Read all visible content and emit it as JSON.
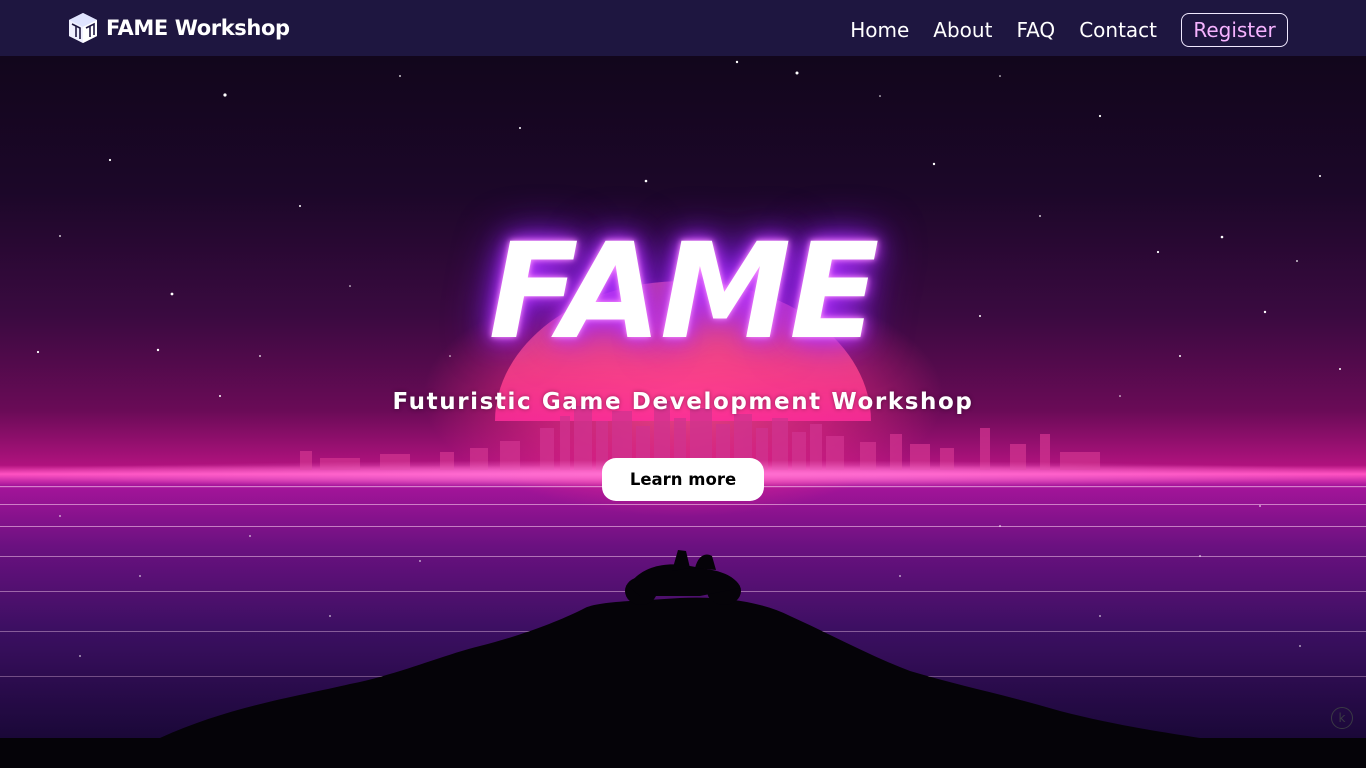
{
  "brand": {
    "name": "FAME Workshop",
    "logo_icon": "cube-logo-icon"
  },
  "nav": {
    "links": [
      "Home",
      "About",
      "FAQ",
      "Contact"
    ],
    "register_label": "Register"
  },
  "hero": {
    "title": "FAME",
    "subtitle": "Futuristic Game Development Workshop",
    "cta_label": "Learn more",
    "corner_icon_label": "k"
  },
  "colors": {
    "navbar_bg": "#1e1640",
    "accent_pink": "#ff4fc0",
    "glow_purple": "#a526ff",
    "register_text": "#f6b3ff"
  }
}
